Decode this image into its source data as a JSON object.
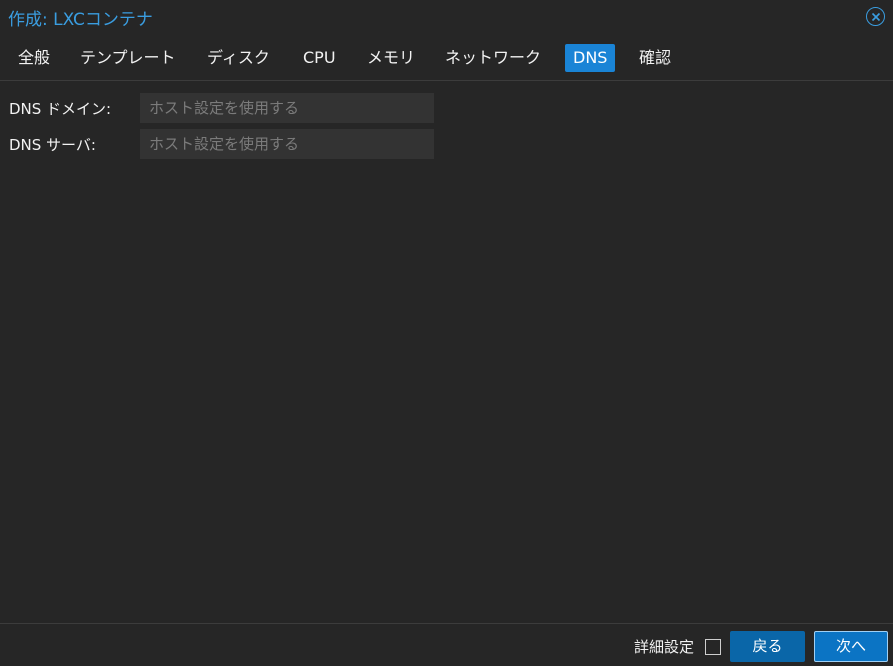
{
  "window": {
    "title": "作成: LXCコンテナ",
    "close_icon": "close-circle-icon"
  },
  "tabs": [
    {
      "label": "全般",
      "active": false
    },
    {
      "label": "テンプレート",
      "active": false
    },
    {
      "label": "ディスク",
      "active": false
    },
    {
      "label": "CPU",
      "active": false
    },
    {
      "label": "メモリ",
      "active": false
    },
    {
      "label": "ネットワーク",
      "active": false
    },
    {
      "label": "DNS",
      "active": true
    },
    {
      "label": "確認",
      "active": false
    }
  ],
  "form": {
    "dns_domain": {
      "label": "DNS ドメイン:",
      "value": "",
      "placeholder": "ホスト設定を使用する"
    },
    "dns_server": {
      "label": "DNS サーバ:",
      "value": "",
      "placeholder": "ホスト設定を使用する"
    }
  },
  "footer": {
    "advanced_label": "詳細設定",
    "advanced_checked": false,
    "back_label": "戻る",
    "next_label": "次へ"
  },
  "colors": {
    "background": "#262626",
    "accent": "#1a84d6",
    "title": "#3a9de0",
    "input_background": "#333333"
  }
}
